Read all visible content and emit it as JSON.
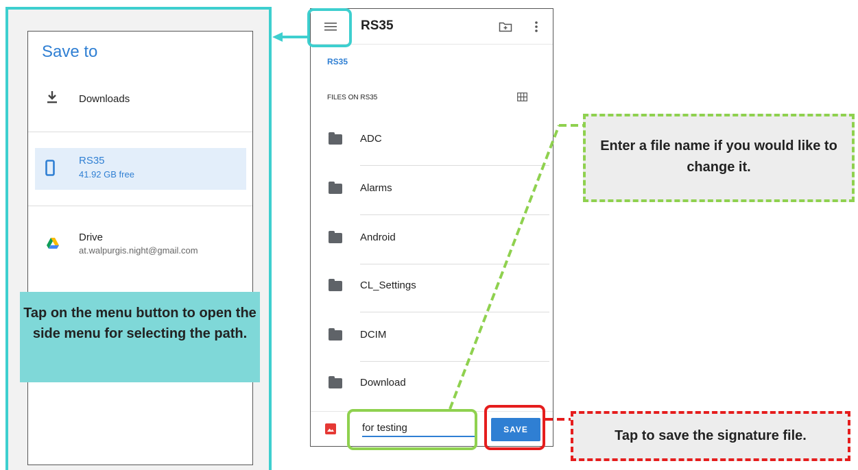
{
  "drawer": {
    "title": "Save to",
    "items": [
      {
        "label": "Downloads",
        "sub": ""
      },
      {
        "label": "RS35",
        "sub": "41.92 GB free"
      },
      {
        "label": "Drive",
        "sub": "at.walpurgis.night@gmail.com"
      }
    ]
  },
  "picker": {
    "title": "RS35",
    "breadcrumb": "RS35",
    "section_label": "FILES ON RS35",
    "files": [
      "ADC",
      "Alarms",
      "Android",
      "CL_Settings",
      "DCIM",
      "Download"
    ],
    "filename_value": "for testing",
    "save_label": "SAVE"
  },
  "callouts": {
    "menu_tip": "Tap on the menu button to open the side menu for selecting the path.",
    "filename_tip": "Enter a file name if you would like to change it.",
    "save_tip": "Tap to save the signature file."
  },
  "colors": {
    "accent_blue": "#2f7fd3",
    "teal": "#3ecfcf",
    "green": "#8fd14f",
    "red": "#e51d1d"
  },
  "icons": [
    "download-icon",
    "phone-icon",
    "drive-icon",
    "menu-icon",
    "new-folder-icon",
    "more-vert-icon",
    "grid-view-icon",
    "folder-icon",
    "image-icon"
  ]
}
